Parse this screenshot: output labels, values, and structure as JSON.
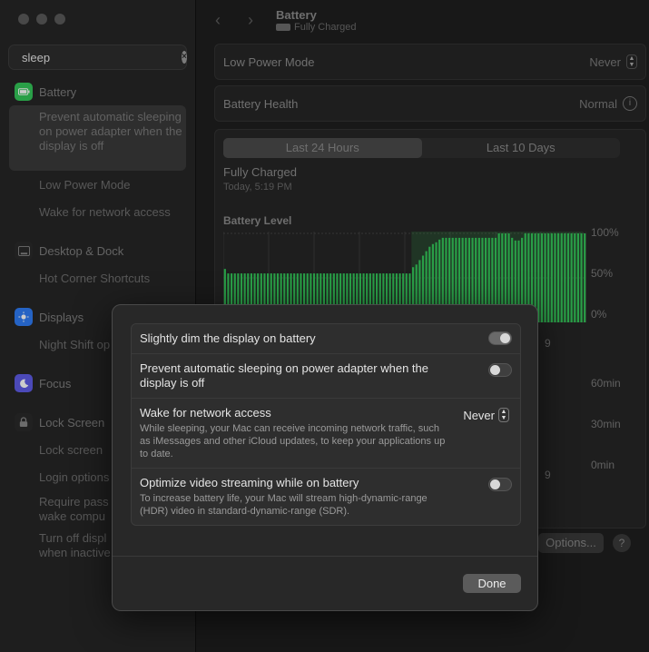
{
  "sidebar": {
    "search": {
      "value": "sleep",
      "placeholder": "Search"
    },
    "sections": [
      {
        "label": "Battery",
        "icon": "battery-icon",
        "color": "#34c759",
        "items": [
          "Prevent automatic sleeping on power adapter when the display is off",
          "Low Power Mode",
          "Wake for network access"
        ]
      },
      {
        "label": "Desktop & Dock",
        "icon": "dock-icon",
        "items": [
          "Hot Corner Shortcuts"
        ]
      },
      {
        "label": "Displays",
        "icon": "displays-icon",
        "color": "#2f7cf6",
        "items": [
          "Night Shift op"
        ]
      },
      {
        "label": "Focus",
        "icon": "moon-icon",
        "color": "#5e5ce6",
        "items": []
      },
      {
        "label": "Lock Screen",
        "icon": "lock-icon",
        "items": [
          "Lock screen",
          "Login options",
          "Require pass wake compu",
          "Turn off displ when inactive"
        ]
      }
    ]
  },
  "header": {
    "title": "Battery",
    "subtitle": "Fully Charged",
    "battery_icon_label": "100"
  },
  "main": {
    "low_power": {
      "label": "Low Power Mode",
      "value": "Never"
    },
    "health": {
      "label": "Battery Health",
      "value": "Normal"
    },
    "tabs": [
      "Last 24 Hours",
      "Last 10 Days"
    ],
    "selected_tab": 0,
    "status": "Fully Charged",
    "status_time": "Today, 5:19 PM",
    "chart_title": "Battery Level",
    "y_ticks": [
      "100%",
      "50%",
      "0%"
    ],
    "usage_ticks": [
      "60min",
      "30min",
      "0min"
    ],
    "x_tick": "9",
    "options_label": "Options...",
    "help_label": "?"
  },
  "chart_data": {
    "type": "bar",
    "title": "Battery Level",
    "ylim": [
      0,
      100
    ],
    "color": "#34c759",
    "values": [
      60,
      55,
      55,
      55,
      55,
      55,
      55,
      55,
      55,
      55,
      55,
      55,
      55,
      55,
      55,
      55,
      55,
      55,
      55,
      55,
      55,
      55,
      55,
      55,
      55,
      55,
      55,
      55,
      55,
      55,
      55,
      55,
      55,
      55,
      55,
      55,
      55,
      55,
      55,
      55,
      55,
      55,
      55,
      55,
      55,
      55,
      55,
      55,
      55,
      55,
      55,
      55,
      55,
      55,
      55,
      55,
      55,
      62,
      65,
      70,
      75,
      80,
      85,
      88,
      90,
      93,
      95,
      95,
      95,
      95,
      95,
      95,
      95,
      95,
      95,
      95,
      95,
      95,
      95,
      95,
      95,
      95,
      95,
      100,
      100,
      100,
      100,
      95,
      92,
      92,
      95,
      100,
      100,
      100,
      100,
      100,
      100,
      100,
      100,
      100,
      100,
      100,
      100,
      100,
      100,
      100,
      100,
      100,
      100,
      100
    ]
  },
  "modal": {
    "rows": [
      {
        "label": "Slightly dim the display on battery",
        "desc": "",
        "control": "toggle",
        "on": true
      },
      {
        "label": "Prevent automatic sleeping on power adapter when the display is off",
        "desc": "",
        "control": "toggle",
        "on": false
      },
      {
        "label": "Wake for network access",
        "desc": "While sleeping, your Mac can receive incoming network traffic, such as iMessages and other iCloud updates, to keep your applications up to date.",
        "control": "select",
        "value": "Never"
      },
      {
        "label": "Optimize video streaming while on battery",
        "desc": "To increase battery life, your Mac will stream high-dynamic-range (HDR) video in standard-dynamic-range (SDR).",
        "control": "toggle",
        "on": false
      }
    ],
    "done_label": "Done"
  }
}
